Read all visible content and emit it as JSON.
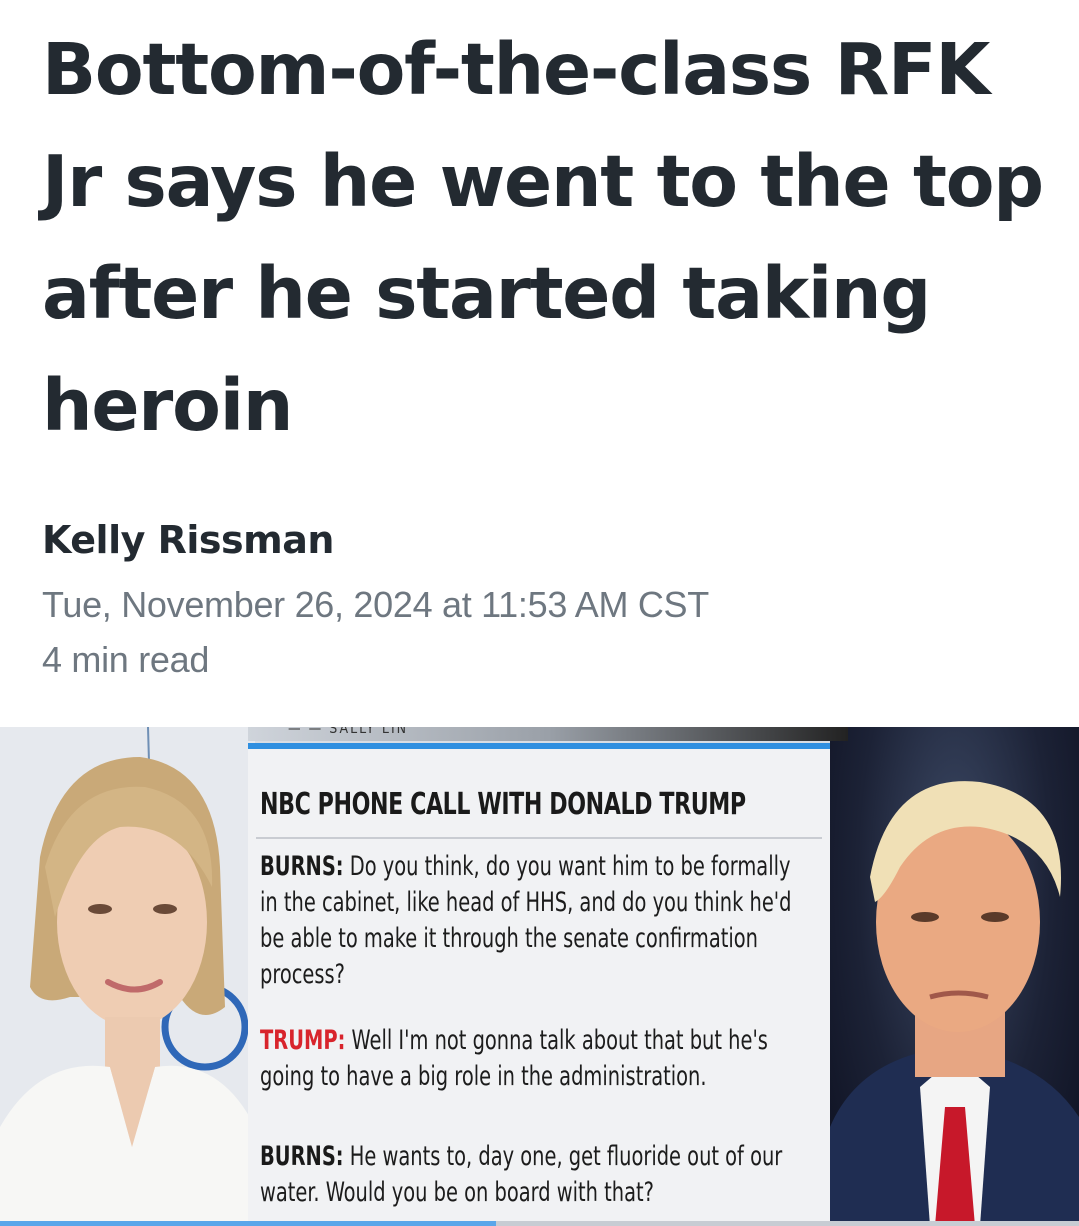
{
  "article": {
    "headline": "Bottom-of-the-class RFK Jr says he went to the top after he started taking heroin",
    "author": "Kelly Rissman",
    "date": "Tue, November 26, 2024 at 11:53 AM CST",
    "read_time": "4 min read"
  },
  "hero": {
    "panel_title": "NBC PHONE CALL WITH DONALD TRUMP",
    "quotes": [
      {
        "speaker": "BURNS:",
        "text": " Do you think, do you want him to be formally in the cabinet, like head of HHS, and do you think he'd be able to make it through the senate confirmation process?"
      },
      {
        "speaker": "TRUMP:",
        "text": " Well I'm not gonna talk about that but he's going to have a big role in the administration."
      },
      {
        "speaker": "BURNS:",
        "text": " He wants to, day one, get fluoride out of our water. Would you be on board with that?"
      }
    ],
    "progress": 0.46,
    "colors": {
      "panel_accent": "#2f8fe0",
      "trump_label": "#d8242c",
      "headline_text": "#232a31",
      "meta_text": "#6e7780"
    }
  }
}
